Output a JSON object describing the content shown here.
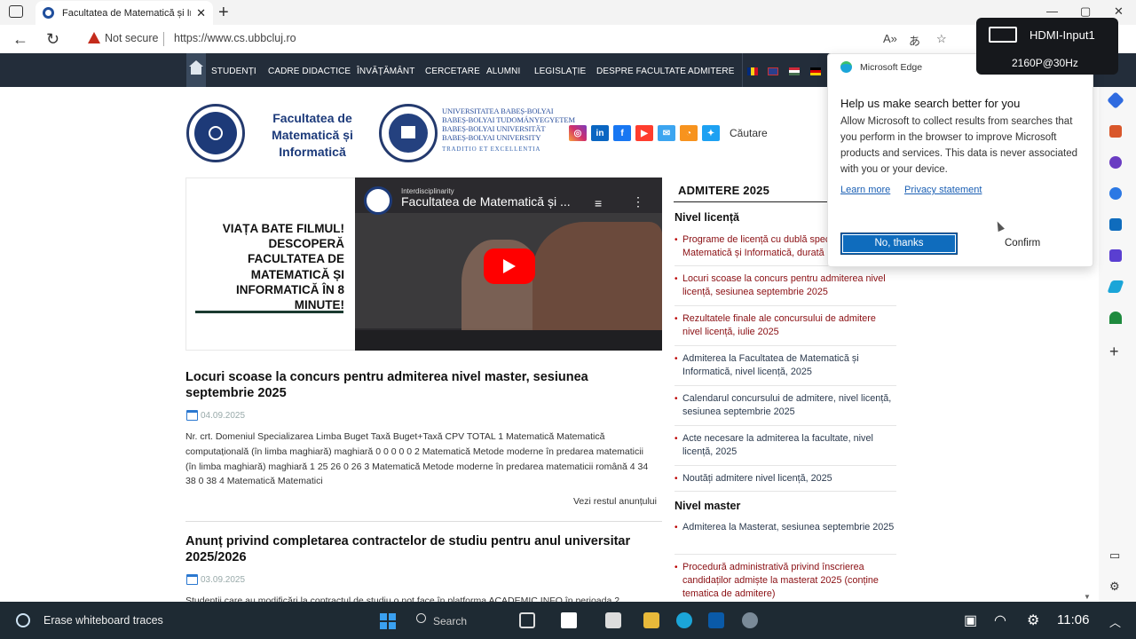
{
  "browser": {
    "tab_title": "Facultatea de Matematică și Info",
    "address": {
      "security_label": "Not secure",
      "url": "https://www.cs.ubbcluj.ro"
    }
  },
  "hdmi_overlay": {
    "input": "HDMI-Input1",
    "mode": "2160P@30Hz"
  },
  "site_nav": {
    "items": [
      "STUDENȚI",
      "CADRE DIDACTICE",
      "ÎNVĂȚĂMÂNT",
      "CERCETARE",
      "ALUMNI",
      "LEGISLAȚIE",
      "DESPRE FACULTATE",
      "ADMITERE"
    ]
  },
  "header": {
    "faculty_name": "Facultatea de Matematică și Informatică",
    "university_lines": [
      "UNIVERSITATEA BABEȘ-BOLYAI",
      "BABEȘ-BOLYAI TUDOMÁNYEGYETEM",
      "BABEȘ-BOLYAI UNIVERSITÄT",
      "BABEȘ-BOLYAI UNIVERSITY"
    ],
    "university_motto": "TRADITIO ET EXCELLENTIA",
    "search_label": "Căutare"
  },
  "promo": {
    "text": "VIAȚA BATE FILMUL! DESCOPERĂ FACULTATEA DE MATEMATICĂ ȘI INFORMATICĂ ÎN 8 MINUTE!"
  },
  "video": {
    "channel_small": "Interdisciplinarity",
    "title": "Facultatea de Matematică și ..."
  },
  "articles": [
    {
      "title": "Locuri scoase la concurs pentru admiterea nivel master, sesiunea septembrie 2025",
      "date": "04.09.2025",
      "excerpt": "Nr. crt. Domeniul Specializarea Limba Buget Taxă Buget+Taxă CPV TOTAL 1 Matematică Matematică computațională (în limba maghiară) maghiară 0 0 0 0 0 2 Matematică Metode moderne în predarea matematicii (în limba maghiară) maghiară 1 25 26 0 26 3 Matematică Metode moderne în predarea matematicii română 4 34 38 0 38 4 Matematică Matematici",
      "more": "Vezi restul anunțului"
    },
    {
      "title": "Anunț privind completarea contractelor de studiu pentru anul universitar 2025/2026",
      "date": "03.09.2025",
      "excerpt": "Studenții care au modificări la contractul de studiu o not face în platforma ACADEMIC INFO în perioada 2"
    }
  ],
  "admission": {
    "title": "ADMITERE 2025",
    "licenta_heading": "Nivel licență",
    "licenta_links": [
      "Programe de licență cu dublă specializare Matematică și Informatică, durată",
      "Locuri scoase la concurs pentru admiterea nivel licență, sesiunea septembrie 2025",
      "Rezultatele finale ale concursului de admitere nivel licență, iulie 2025",
      "Admiterea la Facultatea de Matematică și Informatică, nivel licență, 2025",
      "Calendarul concursului de admitere, nivel licență, sesiunea septembrie 2025",
      "Acte necesare la admiterea la facultate, nivel licență, 2025",
      "Noutăți admitere nivel licență, 2025"
    ],
    "master_heading": "Nivel master",
    "master_links": [
      "Admiterea la Masterat, sesiunea septembrie 2025",
      "Procedură administrativă privind înscrierea candidaților admiște la masterat 2025 (conține tematica de admitere)"
    ]
  },
  "edge_popup": {
    "app_name": "Microsoft Edge",
    "heading": "Help us make search better for you",
    "body": "Allow Microsoft to collect results from searches that you perform in the browser to improve Microsoft products and services. This data is never associated with you or your device.",
    "learn_more": "Learn more",
    "privacy": "Privacy statement",
    "no_thanks": "No, thanks",
    "confirm": "Confirm"
  },
  "taskbar": {
    "erase_label": "Erase whiteboard traces",
    "search_label": "Search",
    "time": "11:06"
  },
  "colors": {
    "nav_bg": "#232d3a",
    "brand_blue": "#1c3a7a",
    "link_red": "#8a0e12",
    "edge_button": "#0f6cbd",
    "taskbar_bg": "#1e2a33"
  }
}
